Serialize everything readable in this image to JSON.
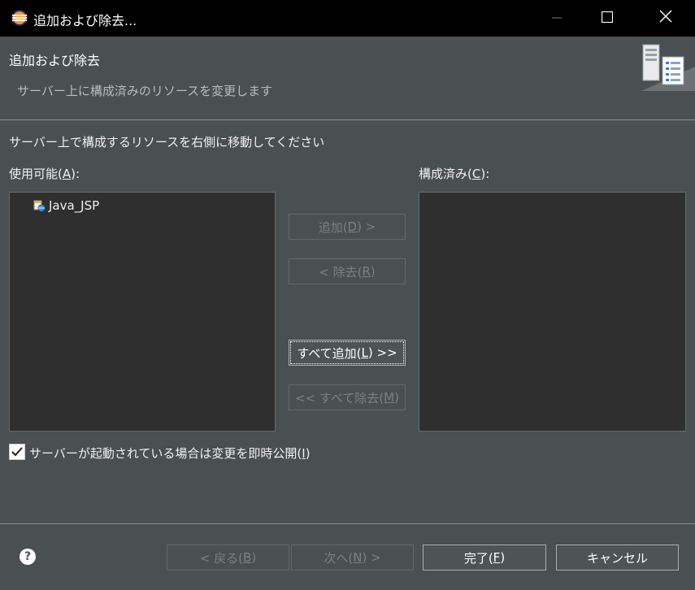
{
  "window": {
    "title": "追加および除去..."
  },
  "header": {
    "title": "追加および除去",
    "description": "サーバー上に構成済みのリソースを変更します",
    "image_icon": "server-config-banner-icon"
  },
  "instruction": "サーバー上で構成するリソースを右側に移動してください",
  "available": {
    "label_pre": "使用可能(",
    "label_key": "A",
    "label_post": "):",
    "items": [
      {
        "label": "Java_JSP",
        "icon": "web-project-icon"
      }
    ]
  },
  "configured": {
    "label_pre": "構成済み(",
    "label_key": "C",
    "label_post": "):",
    "items": []
  },
  "buttons": {
    "add": {
      "pre": "追加(",
      "key": "D",
      "post": ") >",
      "enabled": false
    },
    "remove": {
      "pre": "< 除去(",
      "key": "R",
      "post": ")",
      "enabled": false
    },
    "add_all": {
      "pre": "すべて追加(",
      "key": "L",
      "post": ") >>",
      "enabled": true
    },
    "remove_all": {
      "pre": "<< すべて除去(",
      "key": "M",
      "post": ")",
      "enabled": false
    }
  },
  "publish_checkbox": {
    "checked": true,
    "label_pre": "サーバーが起動されている場合は変更を即時公開(",
    "label_key": "I",
    "label_post": ")"
  },
  "footer": {
    "help_glyph": "?",
    "back": {
      "pre": "< 戻る(",
      "key": "B",
      "post": ")",
      "enabled": false
    },
    "next": {
      "pre": "次へ(",
      "key": "N",
      "post": ") >",
      "enabled": false
    },
    "finish": {
      "pre": "完了(",
      "key": "F",
      "post": ")",
      "enabled": true
    },
    "cancel": {
      "label": "キャンセル",
      "enabled": true
    }
  }
}
